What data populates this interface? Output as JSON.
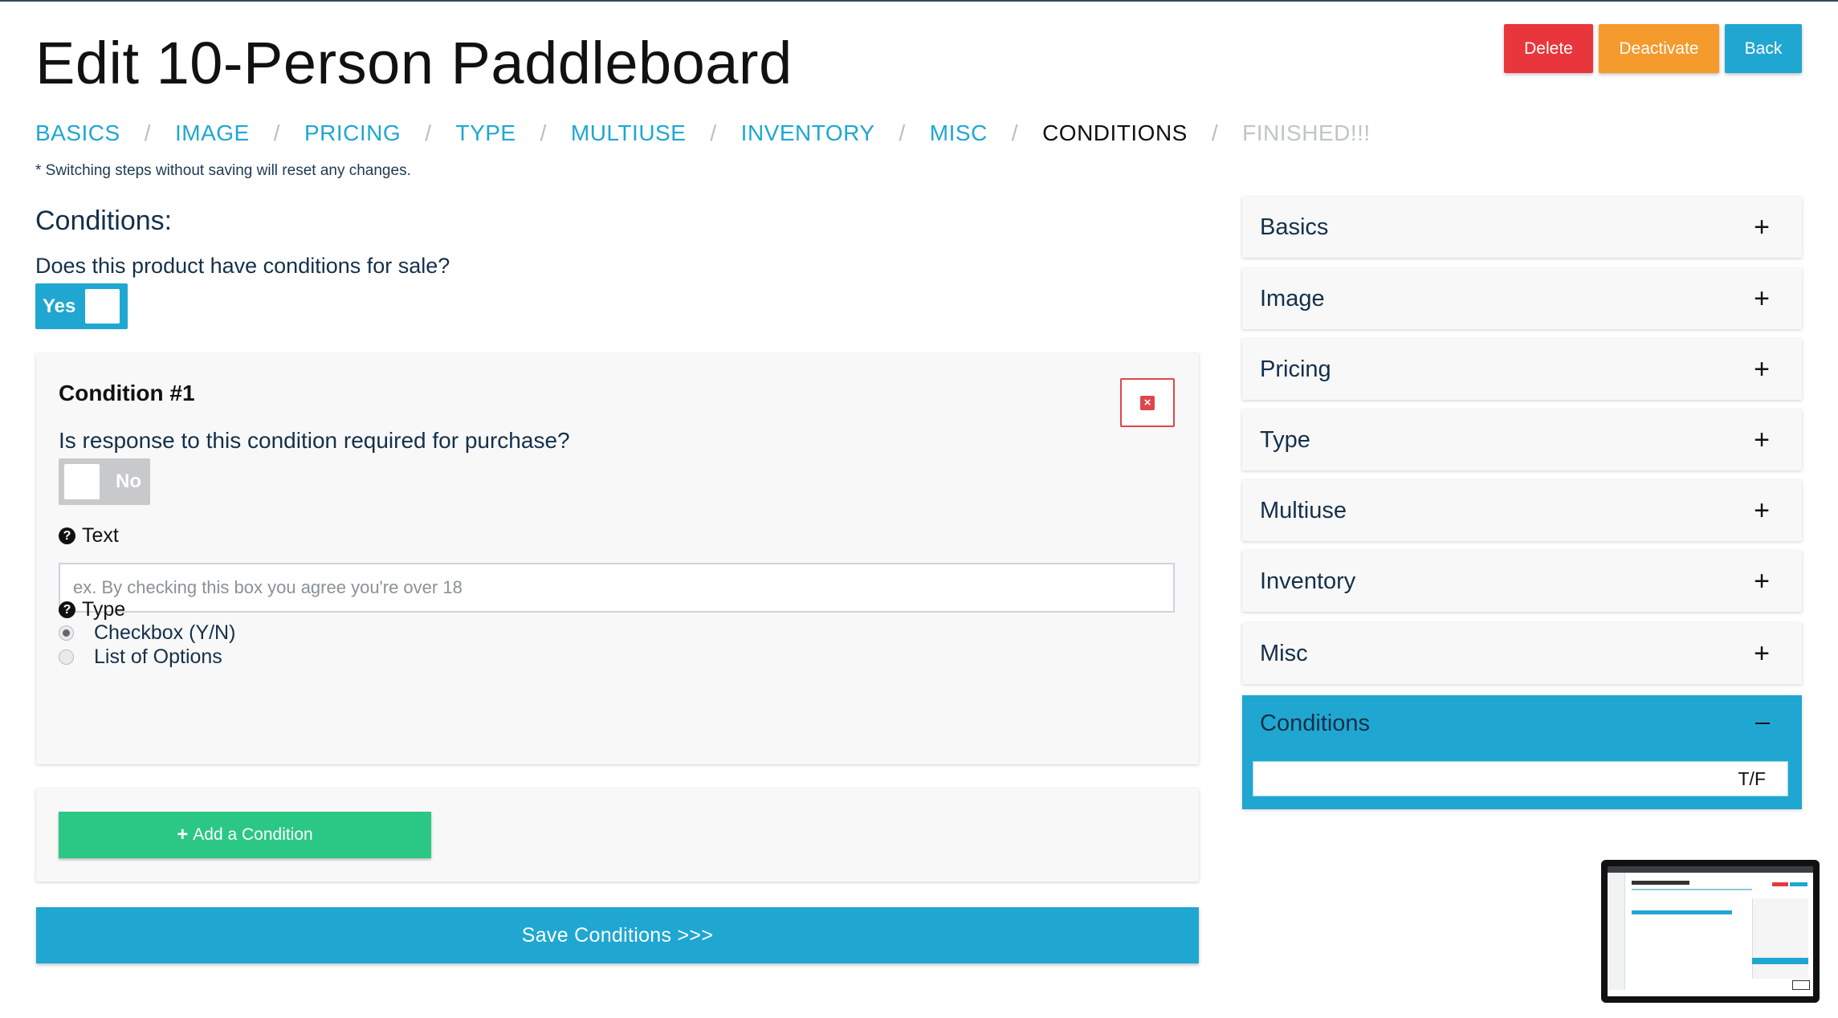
{
  "page": {
    "title": "Edit 10-Person Paddleboard",
    "note": "* Switching steps without saving will reset any changes."
  },
  "actions": {
    "delete": "Delete",
    "deactivate": "Deactivate",
    "back": "Back"
  },
  "steps": [
    {
      "label": "BASICS",
      "state": "link"
    },
    {
      "label": "IMAGE",
      "state": "link"
    },
    {
      "label": "PRICING",
      "state": "link"
    },
    {
      "label": "TYPE",
      "state": "link"
    },
    {
      "label": "MULTIUSE",
      "state": "link"
    },
    {
      "label": "INVENTORY",
      "state": "link"
    },
    {
      "label": "MISC",
      "state": "link"
    },
    {
      "label": "CONDITIONS",
      "state": "current"
    },
    {
      "label": "FINISHED!!!",
      "state": "disabled"
    }
  ],
  "step_separator": "/",
  "conditions": {
    "heading": "Conditions:",
    "question": "Does this product have conditions for sale?",
    "has_conditions_toggle": "Yes",
    "items": [
      {
        "title": "Condition #1",
        "required_question": "Is response to this condition required for purchase?",
        "required_toggle": "No",
        "text_label": "Text",
        "text_value": "",
        "text_placeholder": "ex. By checking this box you agree you're over 18",
        "type_label": "Type",
        "type_options": [
          {
            "label": "Checkbox (Y/N)",
            "checked": true
          },
          {
            "label": "List of Options",
            "checked": false
          }
        ]
      }
    ],
    "add_button": "Add a Condition",
    "save_button": "Save Conditions >>>"
  },
  "summary_panels": [
    {
      "label": "Basics",
      "expanded": false
    },
    {
      "label": "Image",
      "expanded": false
    },
    {
      "label": "Pricing",
      "expanded": false
    },
    {
      "label": "Type",
      "expanded": false
    },
    {
      "label": "Multiuse",
      "expanded": false
    },
    {
      "label": "Inventory",
      "expanded": false
    },
    {
      "label": "Misc",
      "expanded": false
    },
    {
      "label": "Conditions",
      "expanded": true,
      "rows": [
        "T/F"
      ]
    }
  ],
  "icons": {
    "expand": "plus-icon",
    "collapse": "minus-icon",
    "help": "question-circle-icon",
    "remove": "times-square-icon",
    "add": "plus-icon"
  },
  "colors": {
    "primary": "#1fa7d1",
    "danger": "#e8363c",
    "warning": "#f59a2d",
    "success": "#2bc785",
    "toggle_off": "#c8c9ca"
  }
}
